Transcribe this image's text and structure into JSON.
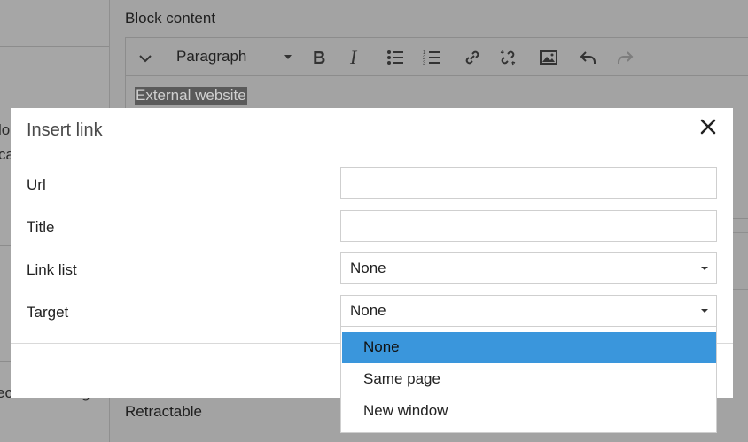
{
  "background": {
    "section_title": "Block content",
    "left_fragments": [
      "lo",
      "ca",
      "ec",
      "g"
    ],
    "toolbar": {
      "block_format": "Paragraph",
      "icons": [
        "chevron-down-icon",
        "bold-icon",
        "italic-icon",
        "bullet-list-icon",
        "numbered-list-icon",
        "link-icon",
        "unlink-icon",
        "image-icon",
        "undo-icon",
        "redo-icon"
      ]
    },
    "editor_text": "External website",
    "retractable_label": "Retractable"
  },
  "modal": {
    "title": "Insert link",
    "fields": {
      "url_label": "Url",
      "url_value": "",
      "title_label": "Title",
      "title_value": "",
      "link_list_label": "Link list",
      "link_list_value": "None",
      "target_label": "Target",
      "target_value": "None"
    },
    "target_options": [
      "None",
      "Same page",
      "New window"
    ],
    "target_selected_index": 0
  },
  "colors": {
    "highlight": "#3a96dc",
    "overlay": "#a3a3a3"
  }
}
